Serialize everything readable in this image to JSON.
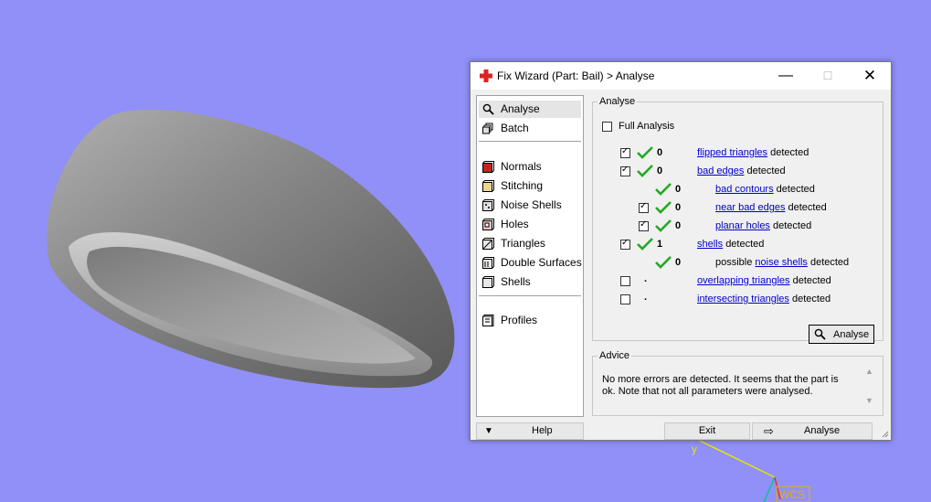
{
  "window": {
    "title": "Fix Wizard (Part: Bail) > Analyse",
    "minimize_glyph": "—",
    "maximize_glyph": "☐",
    "close_glyph": "✕"
  },
  "sidebar": {
    "items": [
      {
        "label": "Analyse",
        "icon": "magnifier-icon",
        "selected": true
      },
      {
        "label": "Batch",
        "icon": "batch-icon"
      },
      {
        "label": "Normals",
        "icon": "normals-cube-icon"
      },
      {
        "label": "Stitching",
        "icon": "stitching-cube-icon"
      },
      {
        "label": "Noise Shells",
        "icon": "noise-shells-icon"
      },
      {
        "label": "Holes",
        "icon": "holes-cube-icon"
      },
      {
        "label": "Triangles",
        "icon": "triangles-cube-icon"
      },
      {
        "label": "Double Surfaces",
        "icon": "double-surfaces-icon"
      },
      {
        "label": "Shells",
        "icon": "shells-icon"
      },
      {
        "label": "Profiles",
        "icon": "profiles-icon"
      }
    ]
  },
  "analyse": {
    "group_label": "Analyse",
    "full_analysis_label": "Full Analysis",
    "detected": "detected",
    "possible": "possible",
    "rows": {
      "flipped": {
        "count": "0",
        "link": "flipped triangles"
      },
      "bad_edges": {
        "count": "0",
        "link": "bad edges"
      },
      "bad_contours": {
        "count": "0",
        "link": "bad contours"
      },
      "near_bad_edges": {
        "count": "0",
        "link": "near bad edges"
      },
      "planar_holes": {
        "count": "0",
        "link": "planar holes"
      },
      "shells": {
        "count": "1",
        "link": "shells"
      },
      "noise_shells": {
        "count": "0",
        "link": "noise shells"
      },
      "overlapping": {
        "count": ".",
        "link": "overlapping triangles"
      },
      "intersecting": {
        "count": ".",
        "link": "intersecting triangles"
      }
    },
    "button_label": "Analyse"
  },
  "advice": {
    "group_label": "Advice",
    "text": "No more errors are detected. It seems that the part is ok. Note that not all parameters were analysed."
  },
  "bottom": {
    "help_label": "Help",
    "exit_label": "Exit",
    "next_label": "Analyse"
  },
  "viewport": {
    "axis_y_label": "y",
    "wcs_label": "WCS"
  },
  "colors": {
    "background": "#9090f8",
    "check_green": "#22aa22",
    "link_blue": "#0000cc",
    "brand_red": "#dd2222"
  }
}
